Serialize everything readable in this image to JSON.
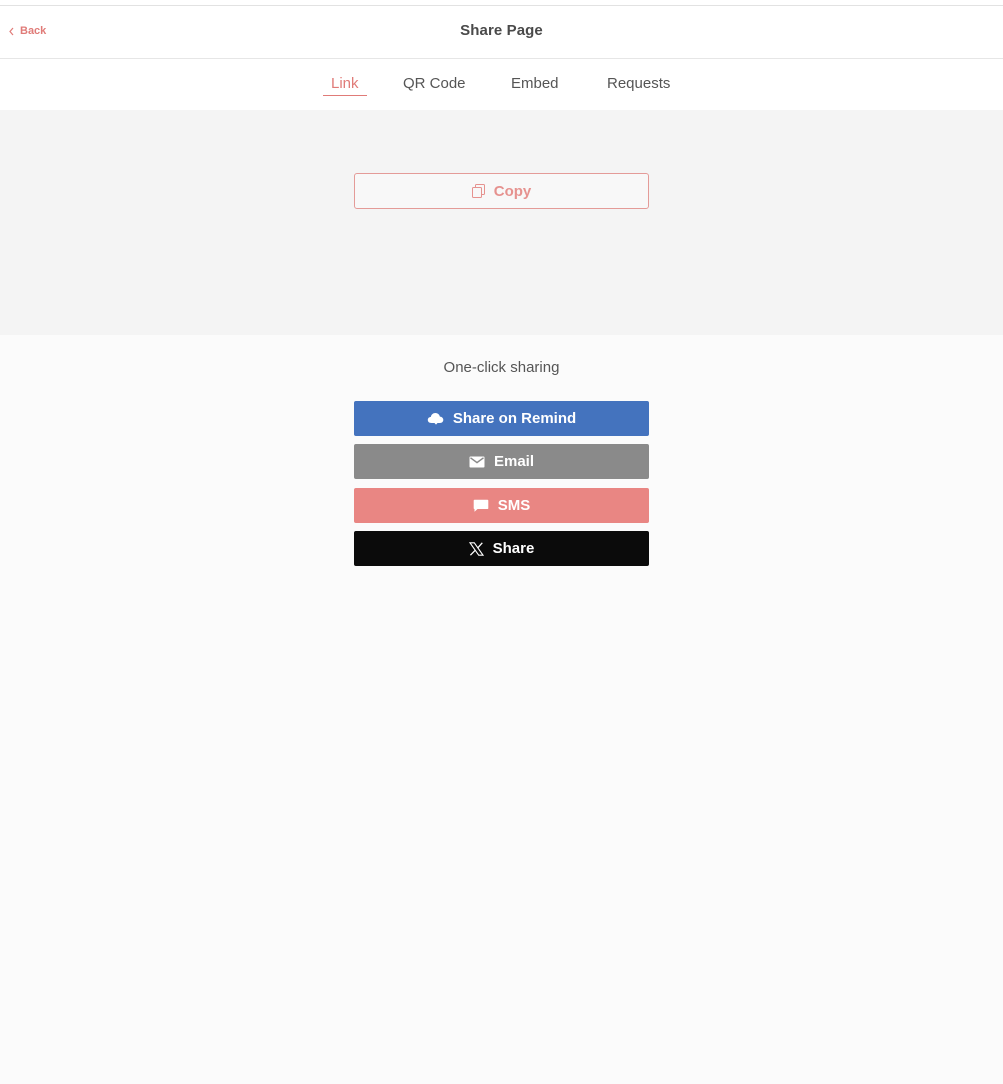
{
  "header": {
    "back_label": "Back",
    "title": "Share Page"
  },
  "tabs": [
    {
      "label": "Link",
      "active": true
    },
    {
      "label": "QR Code",
      "active": false
    },
    {
      "label": "Embed",
      "active": false
    },
    {
      "label": "Requests",
      "active": false
    }
  ],
  "link_panel": {
    "copy_label": "Copy",
    "copy_icon": "copy-icon"
  },
  "sharing": {
    "heading": "One-click sharing",
    "buttons": [
      {
        "label": "Share on Remind",
        "icon": "cloud-icon",
        "color": "#4473be"
      },
      {
        "label": "Email",
        "icon": "envelope-icon",
        "color": "#8a8a8a"
      },
      {
        "label": "SMS",
        "icon": "chat-bubble-icon",
        "color": "#e98683"
      },
      {
        "label": "Share",
        "icon": "x-logo-icon",
        "color": "#0b0b0b"
      }
    ]
  },
  "colors": {
    "accent": "#e07b78",
    "panel_bg": "#f4f4f4",
    "page_bg": "#fbfbfb"
  }
}
